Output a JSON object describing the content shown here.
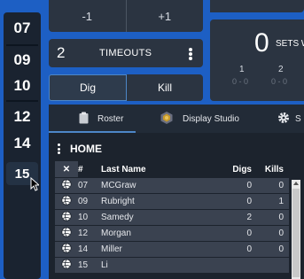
{
  "jerseys": [
    "07",
    "09",
    "10",
    "12",
    "14",
    "15"
  ],
  "step": {
    "minus_label": "-1",
    "plus_label": "+1"
  },
  "timeouts": {
    "count": "2",
    "label": "TIMEOUTS"
  },
  "actions": {
    "dig_label": "Dig",
    "kill_label": "Kill"
  },
  "sets": {
    "value": "0",
    "label": "SETS W",
    "columns": [
      {
        "num": "1",
        "score": "0 - 0"
      },
      {
        "num": "2",
        "score": "0 - 0"
      }
    ]
  },
  "tabs": [
    {
      "label": "Roster",
      "icon": "clipboard-icon"
    },
    {
      "label": "Display Studio",
      "icon": "shield-icon"
    },
    {
      "label": "S",
      "icon": "gear-icon"
    }
  ],
  "section": {
    "title": "HOME"
  },
  "roster": {
    "headers": {
      "x": "✕",
      "num": "#",
      "last_name": "Last Name",
      "digs": "Digs",
      "kills": "Kills"
    },
    "rows": [
      {
        "num": "07",
        "name": "MCGraw",
        "digs": "0",
        "kills": "0"
      },
      {
        "num": "09",
        "name": "Rubright",
        "digs": "0",
        "kills": "1"
      },
      {
        "num": "10",
        "name": "Samedy",
        "digs": "2",
        "kills": "0"
      },
      {
        "num": "12",
        "name": "Morgan",
        "digs": "0",
        "kills": "0"
      },
      {
        "num": "14",
        "name": "Miller",
        "digs": "0",
        "kills": "0"
      },
      {
        "num": "15",
        "name": "Li",
        "digs": "",
        "kills": ""
      }
    ]
  },
  "colors": {
    "background": "#1d5fc4",
    "panel": "#2b3441",
    "accent": "#4d86c7"
  }
}
